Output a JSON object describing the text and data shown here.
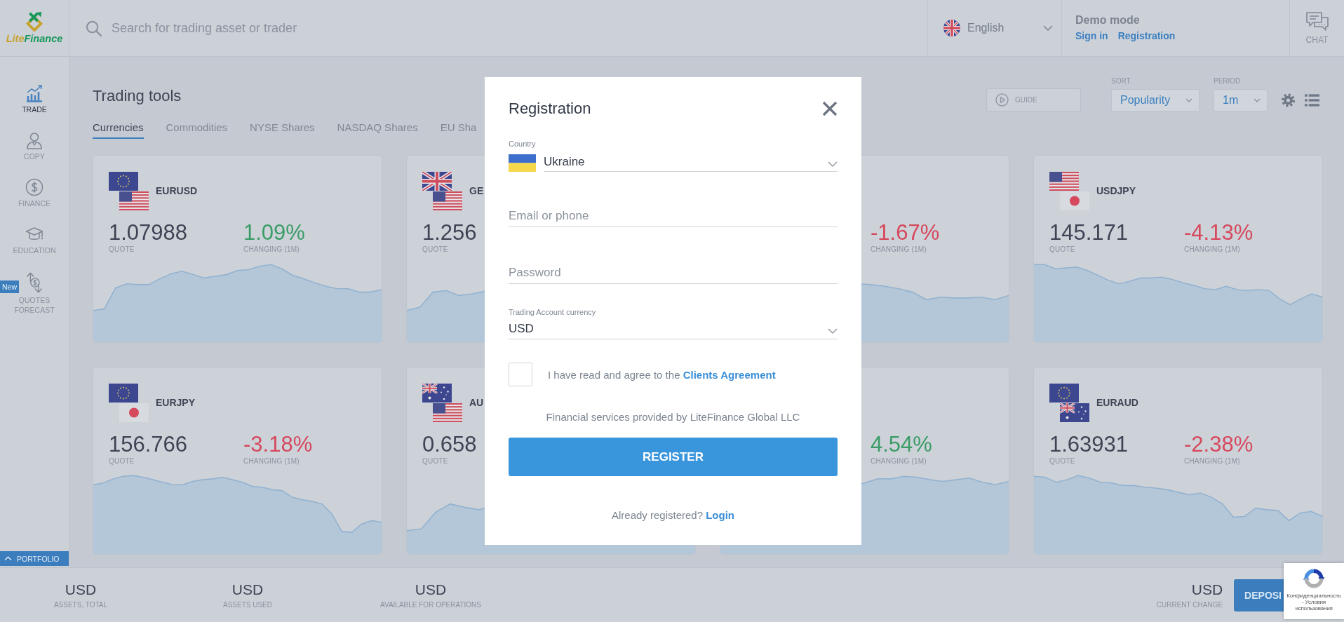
{
  "logo": {
    "text_parts": [
      "Lite",
      "Finance"
    ]
  },
  "search": {
    "placeholder": "Search for trading asset or trader"
  },
  "language": {
    "value": "English"
  },
  "account": {
    "mode": "Demo mode",
    "links": [
      "Sign in",
      "Registration"
    ]
  },
  "chat": {
    "label": "CHAT"
  },
  "sidebar": {
    "items": [
      {
        "label": "TRADE",
        "selected": true
      },
      {
        "label": "COPY",
        "selected": false
      },
      {
        "label": "FINANCE",
        "selected": false
      },
      {
        "label": "EDUCATION",
        "selected": false
      },
      {
        "label": "QUOTES FORECAST",
        "selected": false,
        "badge": "New"
      }
    ],
    "portfolio": "PORTFOLIO"
  },
  "page": {
    "title": "Trading tools",
    "guide": "GUIDE",
    "sort": {
      "label": "SORT",
      "value": "Popularity"
    },
    "period": {
      "label": "PERIOD",
      "value": "1m"
    }
  },
  "tabs": [
    {
      "label": "Currencies",
      "selected": true
    },
    {
      "label": "Commodities",
      "selected": false
    },
    {
      "label": "NYSE Shares",
      "selected": false
    },
    {
      "label": "NASDAQ Shares",
      "selected": false
    },
    {
      "label": "EU Sha",
      "selected": false
    }
  ],
  "cards": [
    {
      "pair": "EURUSD",
      "quote": "1.07988",
      "quote_label": "QUOTE",
      "change": "1.09%",
      "change_label": "CHANGING (1M)",
      "color": "#3a9c66"
    },
    {
      "pair": "GE",
      "quote": "1.256",
      "quote_label": "QUOTE"
    },
    {
      "change": "-1.67%",
      "change_label": "CHANGING (1M)",
      "color": "#d6485c"
    },
    {
      "pair": "USDJPY",
      "quote": "145.171",
      "quote_label": "QUOTE",
      "change": "-4.13%",
      "change_label": "CHANGING (1M)",
      "color": "#d6485c"
    },
    {
      "pair": "EURJPY",
      "quote": "156.766",
      "quote_label": "QUOTE",
      "change": "-3.18%",
      "change_label": "CHANGING (1M)",
      "color": "#d6485c"
    },
    {
      "pair": "AU",
      "quote": "0.658",
      "quote_label": "QUOTE"
    },
    {
      "change": "4.54%",
      "change_label": "CHANGING (1M)",
      "color": "#3a9c66"
    },
    {
      "pair": "EURAUD",
      "quote": "1.63931",
      "quote_label": "QUOTE",
      "change": "-2.38%",
      "change_label": "CHANGING (1M)",
      "color": "#d6485c"
    }
  ],
  "registration_modal": {
    "title": "Registration",
    "country": {
      "label": "Country",
      "value": "Ukraine"
    },
    "email": {
      "placeholder": "Email or phone"
    },
    "password": {
      "placeholder": "Password"
    },
    "currency": {
      "label": "Trading Account currency",
      "value": "USD"
    },
    "agreement": {
      "checked": false,
      "text": "I have read and agree to the",
      "link": "Clients Agreement"
    },
    "provider_note": "Financial services provided by LiteFinance Global LLC",
    "submit": "REGISTER",
    "login_prompt": {
      "text": "Already registered?",
      "link": "Login"
    }
  },
  "portfolio_bar": {
    "items": [
      {
        "value": "USD",
        "label": "ASSETS, TOTAL"
      },
      {
        "value": "USD",
        "label": "ASSETS USED"
      },
      {
        "value": "USD",
        "label": "AVAILABLE FOR OPERATIONS"
      }
    ],
    "current_change": {
      "value": "USD",
      "label": "CURRENT CHANGE"
    },
    "deposit": "DEPOSI"
  },
  "recaptcha": {
    "text": "Конфиденциальность - Условия использования"
  }
}
